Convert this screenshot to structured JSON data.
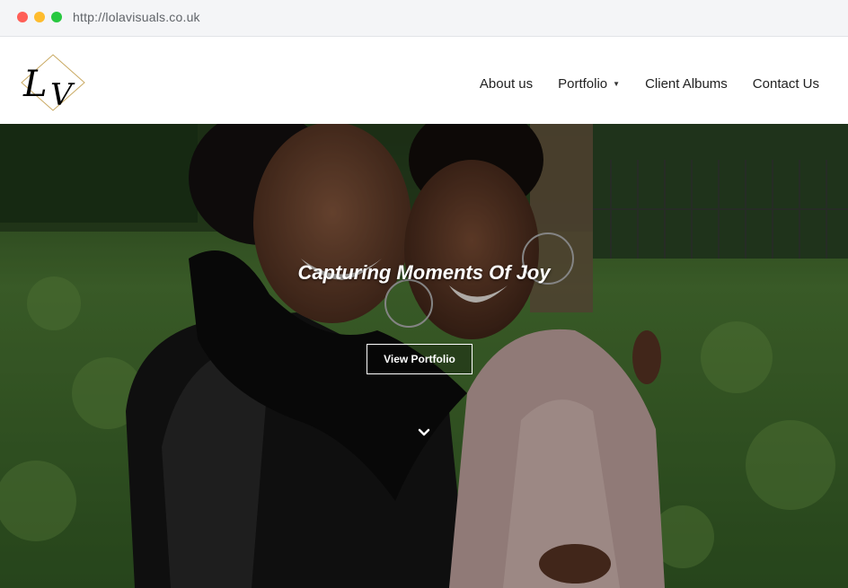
{
  "browser": {
    "url": "http://lolavisuals.co.uk"
  },
  "header": {
    "logo_text": "LV",
    "nav": [
      {
        "label": "About us"
      },
      {
        "label": "Portfolio",
        "has_dropdown": true
      },
      {
        "label": "Client Albums"
      },
      {
        "label": "Contact Us"
      }
    ]
  },
  "hero": {
    "title": "Capturing Moments Of Joy",
    "button_label": "View Portfolio",
    "scroll_icon": "chevron-down-icon"
  },
  "colors": {
    "accent_gold": "#c9a961",
    "text_dark": "#222222",
    "foliage_green": "#3f6b2a"
  }
}
